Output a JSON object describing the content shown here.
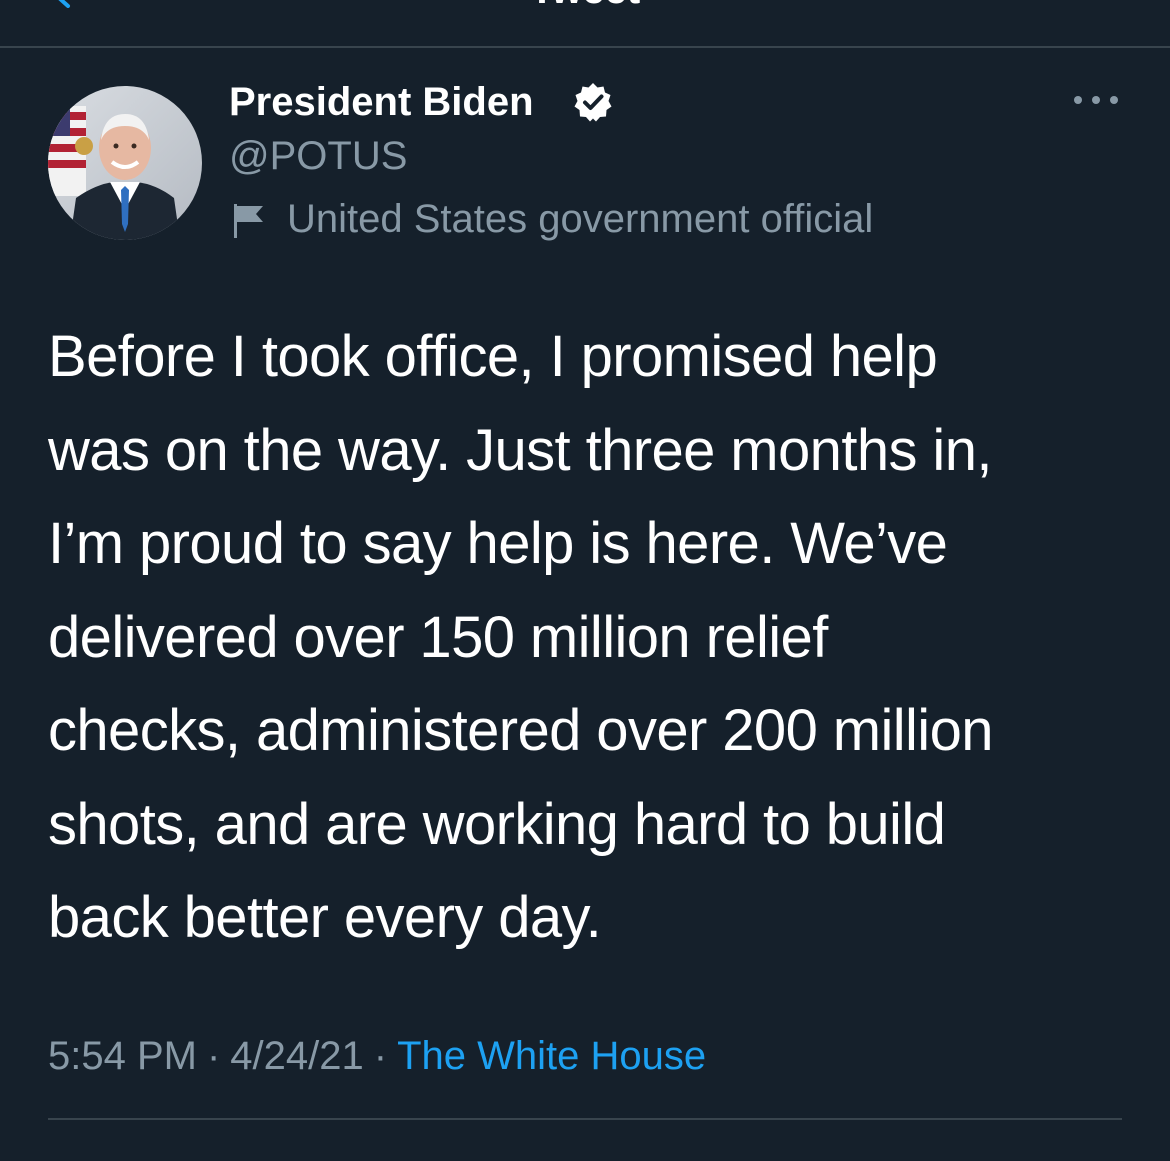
{
  "header": {
    "title": "Tweet"
  },
  "author": {
    "display_name": "President Biden",
    "handle": "@POTUS",
    "label": "United States government official",
    "verified": true
  },
  "tweet": {
    "lines": [
      "Before I took office, I promised help",
      "was on the way. Just three months in,",
      "I’m proud to say help is here. We’ve",
      "delivered over 150 million relief",
      "checks, administered over 200 million",
      "shots, and are working hard to build",
      "back better every day."
    ]
  },
  "meta": {
    "time": "5:54 PM",
    "separator": "·",
    "date": "4/24/21",
    "source": "The White House"
  },
  "colors": {
    "background": "#15202b",
    "primary_text": "#ffffff",
    "secondary_text": "#8899a6",
    "link": "#1da1f2",
    "divider": "#38444d"
  },
  "icons": {
    "back": "chevron-left-icon",
    "verified": "verified-badge-icon",
    "more": "more-horizontal-icon",
    "label": "flag-icon"
  }
}
